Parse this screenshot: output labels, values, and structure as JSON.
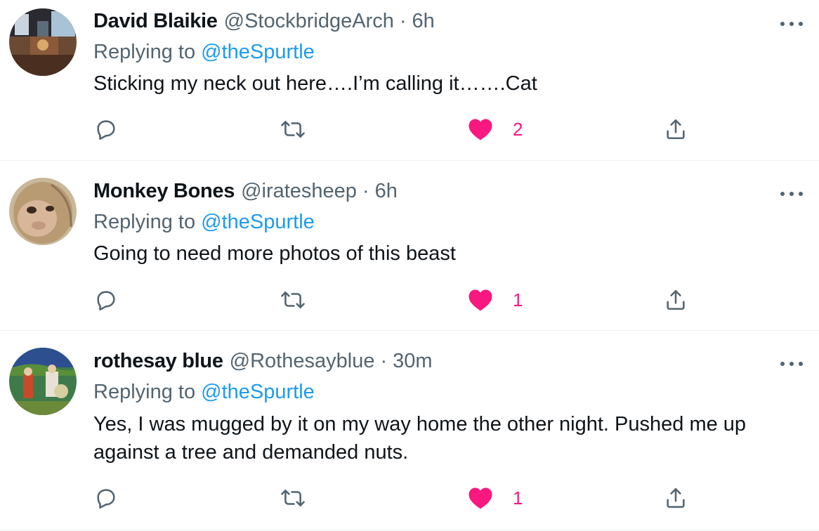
{
  "colors": {
    "text": "#0f1419",
    "secondary": "#536471",
    "link": "#1d9bf0",
    "like": "#f91880",
    "divider": "#eff3f4"
  },
  "tweets": [
    {
      "name": "David Blaikie",
      "handle": "@StockbridgeArch",
      "separator": "·",
      "time": "6h",
      "replying_prefix": "Replying to",
      "replying_to": "@theSpurtle",
      "text": "Sticking my neck out here….I’m calling it…….Cat",
      "likes": "2",
      "avatar_icon": "interior-photo-avatar"
    },
    {
      "name": "Monkey Bones",
      "handle": "@iratesheep",
      "separator": "·",
      "time": "6h",
      "replying_prefix": "Replying to",
      "replying_to": "@theSpurtle",
      "text": "Going to need more photos of this beast",
      "likes": "1",
      "avatar_icon": "monkey-face-avatar"
    },
    {
      "name": "rothesay blue",
      "handle": "@Rothesayblue",
      "separator": "·",
      "time": "30m",
      "replying_prefix": "Replying to",
      "replying_to": "@theSpurtle",
      "text": "Yes, I was mugged by it on my way home the other night. Pushed me up against a tree and demanded nuts.",
      "likes": "1",
      "avatar_icon": "medieval-painting-avatar"
    }
  ],
  "icons": {
    "reply": "reply-icon",
    "retweet": "retweet-icon",
    "like": "heart-filled-icon",
    "share": "share-icon",
    "more": "more-options-icon"
  }
}
